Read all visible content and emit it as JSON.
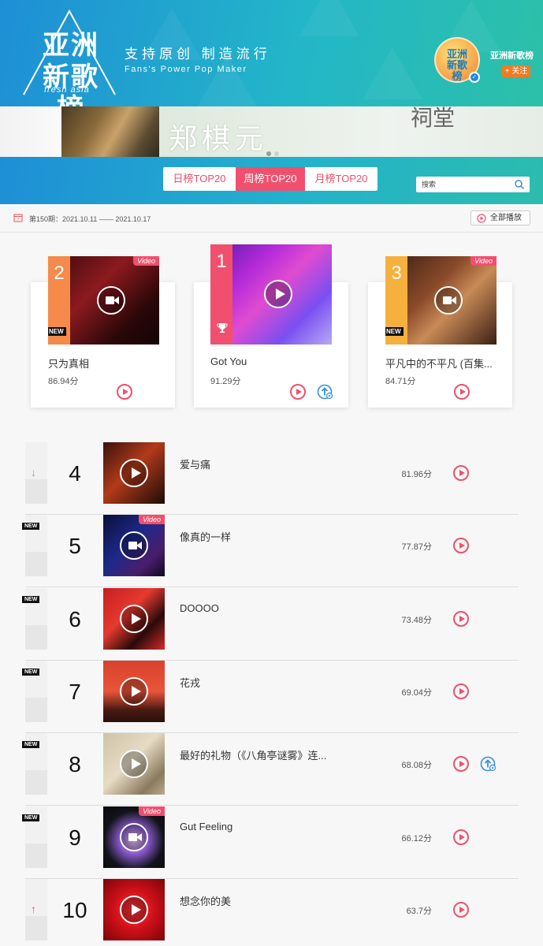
{
  "header": {
    "logo_main": "亚洲新歌榜",
    "logo_sub": "fresh asia",
    "slogan_cn": "支持原创  制造流行",
    "slogan_en": "Fans's Power   Pop Maker",
    "account_name": "亚洲新歌榜",
    "follow_label": "+ 关注",
    "avatar_text": "亚洲新歌榜"
  },
  "banner": {
    "title": "郑棋元",
    "title2": "祠堂"
  },
  "tabs": [
    {
      "label": "日榜TOP20",
      "active": false
    },
    {
      "label": "周榜TOP20",
      "active": true
    },
    {
      "label": "月榜TOP20",
      "active": false
    }
  ],
  "search": {
    "placeholder": "搜索",
    "icon": "search-icon"
  },
  "period": {
    "text": "第150期：2021.10.11 —— 2021.10.17",
    "play_all_label": "全部播放"
  },
  "top3": [
    {
      "rank": "2",
      "title": "只为真相",
      "score": "86.94分",
      "badge_new": "NEW",
      "badge_video": "Video",
      "rank_color": "#f58a4a"
    },
    {
      "rank": "1",
      "title": "Got You",
      "score": "91.29分",
      "rank_color": "#f0506e",
      "trophy": true,
      "has_upload": true
    },
    {
      "rank": "3",
      "title": "平凡中的不平凡 (百集...",
      "score": "84.71分",
      "badge_new": "NEW",
      "badge_video": "Video",
      "rank_color": "#f5b03e"
    }
  ],
  "list": [
    {
      "rank": "4",
      "title": "爱与痛",
      "score": "81.96分",
      "trend": "down",
      "trend_symbol": "↓",
      "is_new": false,
      "video": false,
      "has_upload": false
    },
    {
      "rank": "5",
      "title": "像真的一样",
      "score": "77.87分",
      "trend": "new",
      "is_new": true,
      "video": true,
      "has_upload": false
    },
    {
      "rank": "6",
      "title": "DOOOO",
      "score": "73.48分",
      "trend": "new",
      "is_new": true,
      "video": false,
      "has_upload": false
    },
    {
      "rank": "7",
      "title": "花戎",
      "score": "69.04分",
      "trend": "new",
      "is_new": true,
      "video": false,
      "has_upload": false
    },
    {
      "rank": "8",
      "title": "最好的礼物（《八角亭谜雾》连...",
      "score": "68.08分",
      "trend": "new",
      "is_new": true,
      "video": false,
      "has_upload": true
    },
    {
      "rank": "9",
      "title": "Gut Feeling",
      "score": "66.12分",
      "trend": "new",
      "is_new": true,
      "video": true,
      "has_upload": false
    },
    {
      "rank": "10",
      "title": "想念你的美",
      "score": "63.7分",
      "trend": "up",
      "trend_symbol": "↑",
      "is_new": false,
      "video": false,
      "has_upload": false
    }
  ],
  "labels": {
    "new": "NEW",
    "video": "Video"
  },
  "colors": {
    "accent": "#f0506e",
    "header_blue": "#1e8fd6",
    "header_teal": "#2cc0a8",
    "follow_orange": "#f07b21"
  }
}
